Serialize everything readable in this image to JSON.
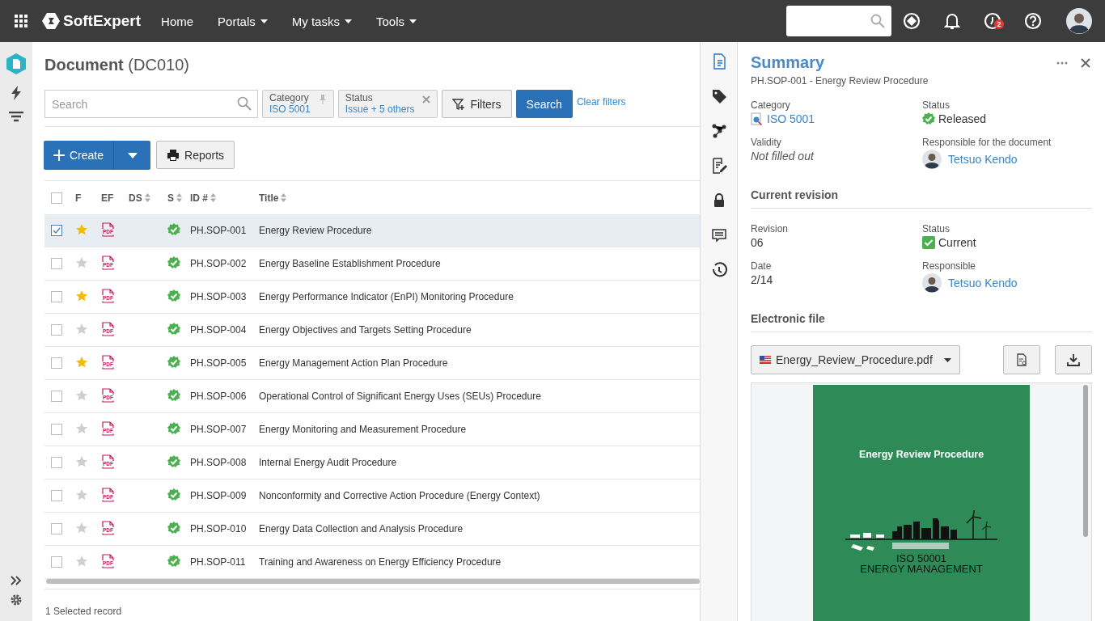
{
  "topbar": {
    "brand": "SoftExpert",
    "nav": [
      {
        "label": "Home",
        "dropdown": false
      },
      {
        "label": "Portals",
        "dropdown": true
      },
      {
        "label": "My tasks",
        "dropdown": true
      },
      {
        "label": "Tools",
        "dropdown": true
      }
    ],
    "task_badge": "2"
  },
  "sidebar": {
    "items": [
      {
        "kind": "documents",
        "selected": true
      },
      {
        "kind": "actions",
        "selected": false
      },
      {
        "kind": "filters",
        "selected": false
      }
    ]
  },
  "page": {
    "title": "Document",
    "code": "(DC010)"
  },
  "search": {
    "placeholder": "Search"
  },
  "filter_chips": [
    {
      "label": "Category",
      "value": "ISO 5001",
      "kind": "pin"
    },
    {
      "label": "Status",
      "value": "Issue + 5 others",
      "kind": "remove"
    }
  ],
  "filters_button": "Filters",
  "search_button": "Search",
  "clear_filters": "Clear filters",
  "create_button": "Create",
  "reports_button": "Reports",
  "table": {
    "columns": [
      "F",
      "EF",
      "DS",
      "S",
      "ID #",
      "Title"
    ],
    "all_checked": false,
    "rows": [
      {
        "checked": true,
        "favorite": true,
        "file": "PDF",
        "id": "PH.SOP-001",
        "title": "Energy Review Procedure"
      },
      {
        "checked": false,
        "favorite": false,
        "file": "PDF",
        "id": "PH.SOP-002",
        "title": "Energy Baseline Establishment Procedure"
      },
      {
        "checked": false,
        "favorite": true,
        "file": "PDF",
        "id": "PH.SOP-003",
        "title": "Energy Performance Indicator (EnPI) Monitoring Procedure"
      },
      {
        "checked": false,
        "favorite": false,
        "file": "PDF",
        "id": "PH.SOP-004",
        "title": "Energy Objectives and Targets Setting Procedure"
      },
      {
        "checked": false,
        "favorite": true,
        "file": "PDF",
        "id": "PH.SOP-005",
        "title": "Energy Management Action Plan Procedure"
      },
      {
        "checked": false,
        "favorite": false,
        "file": "PDF",
        "id": "PH.SOP-006",
        "title": "Operational Control of Significant Energy Uses (SEUs) Procedure"
      },
      {
        "checked": false,
        "favorite": false,
        "file": "PDF",
        "id": "PH.SOP-007",
        "title": "Energy Monitoring and Measurement Procedure"
      },
      {
        "checked": false,
        "favorite": false,
        "file": "PDF",
        "id": "PH.SOP-008",
        "title": "Internal Energy Audit Procedure"
      },
      {
        "checked": false,
        "favorite": false,
        "file": "PDF",
        "id": "PH.SOP-009",
        "title": "Nonconformity and Corrective Action Procedure (Energy Context)"
      },
      {
        "checked": false,
        "favorite": false,
        "file": "PDF",
        "id": "PH.SOP-010",
        "title": "Energy Data Collection and Analysis Procedure"
      },
      {
        "checked": false,
        "favorite": false,
        "file": "PDF",
        "id": "PH.SOP-011",
        "title": "Training and Awareness on Energy Efficiency Procedure"
      }
    ]
  },
  "status_bar": "1 Selected record",
  "panel_tabs": [
    {
      "kind": "document",
      "selected": true
    },
    {
      "kind": "tag",
      "selected": false
    },
    {
      "kind": "relations",
      "selected": false
    },
    {
      "kind": "edit",
      "selected": false
    },
    {
      "kind": "lock",
      "selected": false
    },
    {
      "kind": "comments",
      "selected": false
    },
    {
      "kind": "history",
      "selected": false
    }
  ],
  "summary": {
    "title": "Summary",
    "subtitle": "PH.SOP-001 - Energy Review Procedure",
    "fields": [
      {
        "label": "Category",
        "value": "ISO 5001",
        "kind": "category"
      },
      {
        "label": "Status",
        "value": "Released",
        "kind": "released"
      },
      {
        "label": "Validity",
        "value": "Not filled out",
        "kind": "empty"
      },
      {
        "label": "Responsible for the document",
        "value": "Tetsuo Kendo",
        "kind": "person"
      }
    ],
    "revision_heading": "Current revision",
    "revision_fields": [
      {
        "label": "Revision",
        "value": "06",
        "kind": "plain"
      },
      {
        "label": "Status",
        "value": "Current",
        "kind": "current"
      },
      {
        "label": "Date",
        "value": "2/14",
        "kind": "plain"
      },
      {
        "label": "Responsible",
        "value": "Tetsuo Kendo",
        "kind": "person"
      }
    ],
    "file_heading": "Electronic file",
    "file_name": "Energy_Review_Procedure.pdf",
    "preview": {
      "title": "Energy Review Procedure",
      "logo_line1": "ISO 50001",
      "logo_line2": "ENERGY MANAGEMENT"
    }
  }
}
